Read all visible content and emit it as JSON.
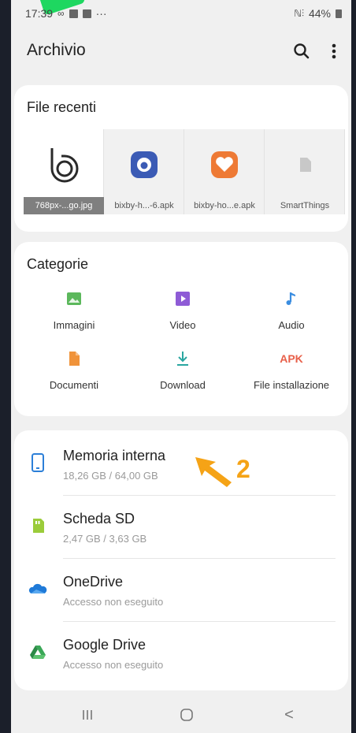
{
  "status": {
    "time": "17:39",
    "battery": "44%",
    "more": "···"
  },
  "header": {
    "title": "Archivio"
  },
  "recent": {
    "title": "File recenti",
    "files": [
      {
        "name": "768px-...go.jpg",
        "icon": "bixby-logo"
      },
      {
        "name": "bixby-h...-6.apk",
        "icon": "bixby-app-icon"
      },
      {
        "name": "bixby-ho...e.apk",
        "icon": "heart-app-icon"
      },
      {
        "name": "SmartThings",
        "icon": "document-icon"
      }
    ]
  },
  "categories": {
    "title": "Categorie",
    "items": [
      {
        "label": "Immagini",
        "icon": "image-icon",
        "color": "#5cb85c"
      },
      {
        "label": "Video",
        "icon": "video-icon",
        "color": "#8e5bd6"
      },
      {
        "label": "Audio",
        "icon": "music-note-icon",
        "color": "#3a8de0"
      },
      {
        "label": "Documenti",
        "icon": "document-icon",
        "color": "#f0933a"
      },
      {
        "label": "Download",
        "icon": "download-icon",
        "color": "#2aa6a0"
      },
      {
        "label": "File installazione",
        "icon": "apk-icon",
        "icon_text": "APK",
        "color": "#e8604a"
      }
    ]
  },
  "storage": {
    "items": [
      {
        "name": "Memoria interna",
        "detail": "18,26 GB / 64,00 GB",
        "icon": "phone-icon",
        "color": "#2c7fd8"
      },
      {
        "name": "Scheda SD",
        "detail": "2,47 GB / 3,63 GB",
        "icon": "sd-card-icon",
        "color": "#9bcc3a"
      },
      {
        "name": "OneDrive",
        "detail": "Accesso non eseguito",
        "icon": "cloud-icon",
        "color": "#1f7ad8"
      },
      {
        "name": "Google Drive",
        "detail": "Accesso non eseguito",
        "icon": "google-drive-icon",
        "color": "#3aa757"
      }
    ]
  },
  "annotation": {
    "number": "2",
    "color": "#f5a316"
  },
  "navbar": {
    "back_glyph": "<"
  }
}
